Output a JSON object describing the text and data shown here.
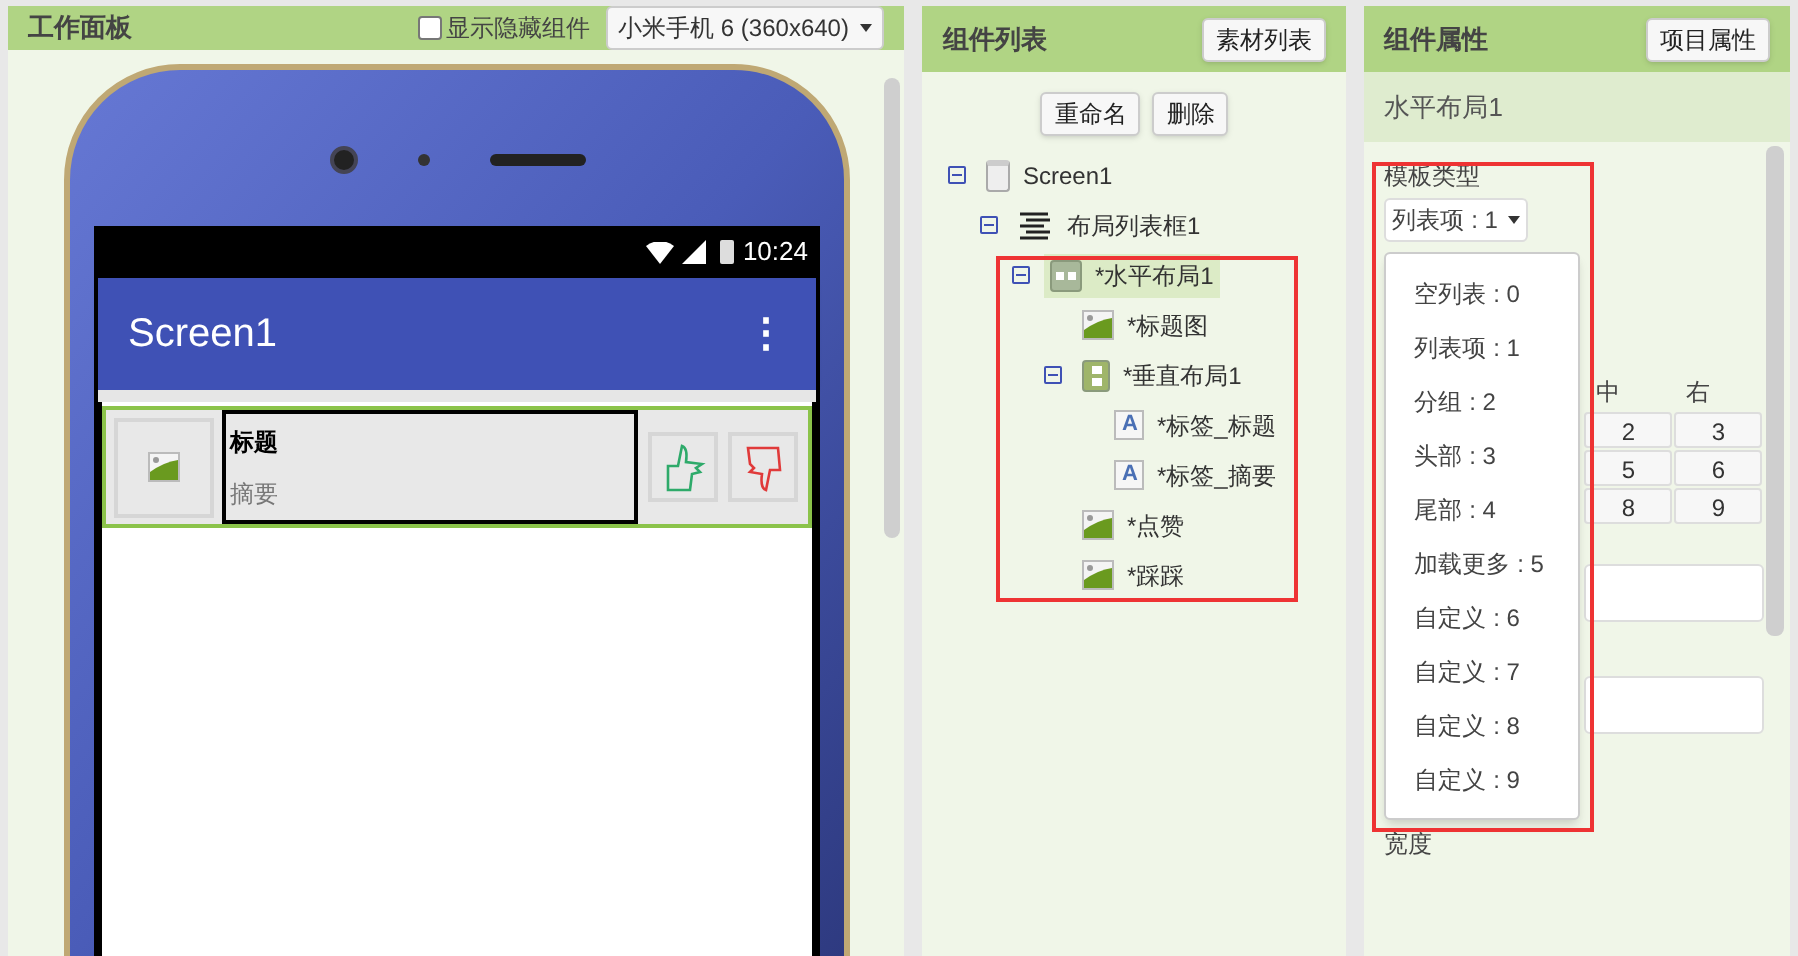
{
  "workspace": {
    "title": "工作面板",
    "show_hidden": {
      "label": "显示隐藏组件",
      "checked": false
    },
    "device": "小米手机 6 (360x640)",
    "phone": {
      "time": "10:24",
      "app_title": "Screen1",
      "menu_glyph": "⋮",
      "list_item": {
        "title": "标题",
        "summary": "摘要"
      }
    }
  },
  "components": {
    "title": "组件列表",
    "media_button": "素材列表",
    "buttons": [
      "重命名",
      "删除"
    ],
    "tree": [
      {
        "label": "Screen1",
        "kind": "screen",
        "expanded": true,
        "selected": false,
        "children": [
          {
            "label": "布局列表框1",
            "kind": "listview",
            "expanded": true,
            "selected": false,
            "children": [
              {
                "label": "*水平布局1",
                "kind": "horizontal",
                "expanded": true,
                "selected": true,
                "children": [
                  {
                    "label": "*标题图",
                    "kind": "image",
                    "selected": false
                  },
                  {
                    "label": "*垂直布局1",
                    "kind": "vertical",
                    "expanded": true,
                    "selected": false,
                    "children": [
                      {
                        "label": "*标签_标题",
                        "kind": "label",
                        "icon_letter": "A",
                        "selected": false
                      },
                      {
                        "label": "*标签_摘要",
                        "kind": "label",
                        "icon_letter": "A",
                        "selected": false
                      }
                    ]
                  },
                  {
                    "label": "*点赞",
                    "kind": "image",
                    "selected": false
                  },
                  {
                    "label": "*踩踩",
                    "kind": "image",
                    "selected": false
                  }
                ]
              }
            ]
          }
        ]
      }
    ]
  },
  "properties": {
    "title": "组件属性",
    "project_button": "项目属性",
    "component": "水平布局1",
    "template_label": "模板类型",
    "template_value": "列表项 : 1",
    "align_headers": [
      "中",
      "右"
    ],
    "align_cells": [
      [
        "2",
        "3"
      ],
      [
        "5",
        "6"
      ],
      [
        "8",
        "9"
      ]
    ],
    "width_label": "宽度",
    "dropdown": [
      "空列表 : 0",
      "列表项 : 1",
      "分组 : 2",
      "头部 : 3",
      "尾部 : 4",
      "加载更多 : 5",
      "自定义 : 6",
      "自定义 : 7",
      "自定义 : 8",
      "自定义 : 9"
    ]
  }
}
